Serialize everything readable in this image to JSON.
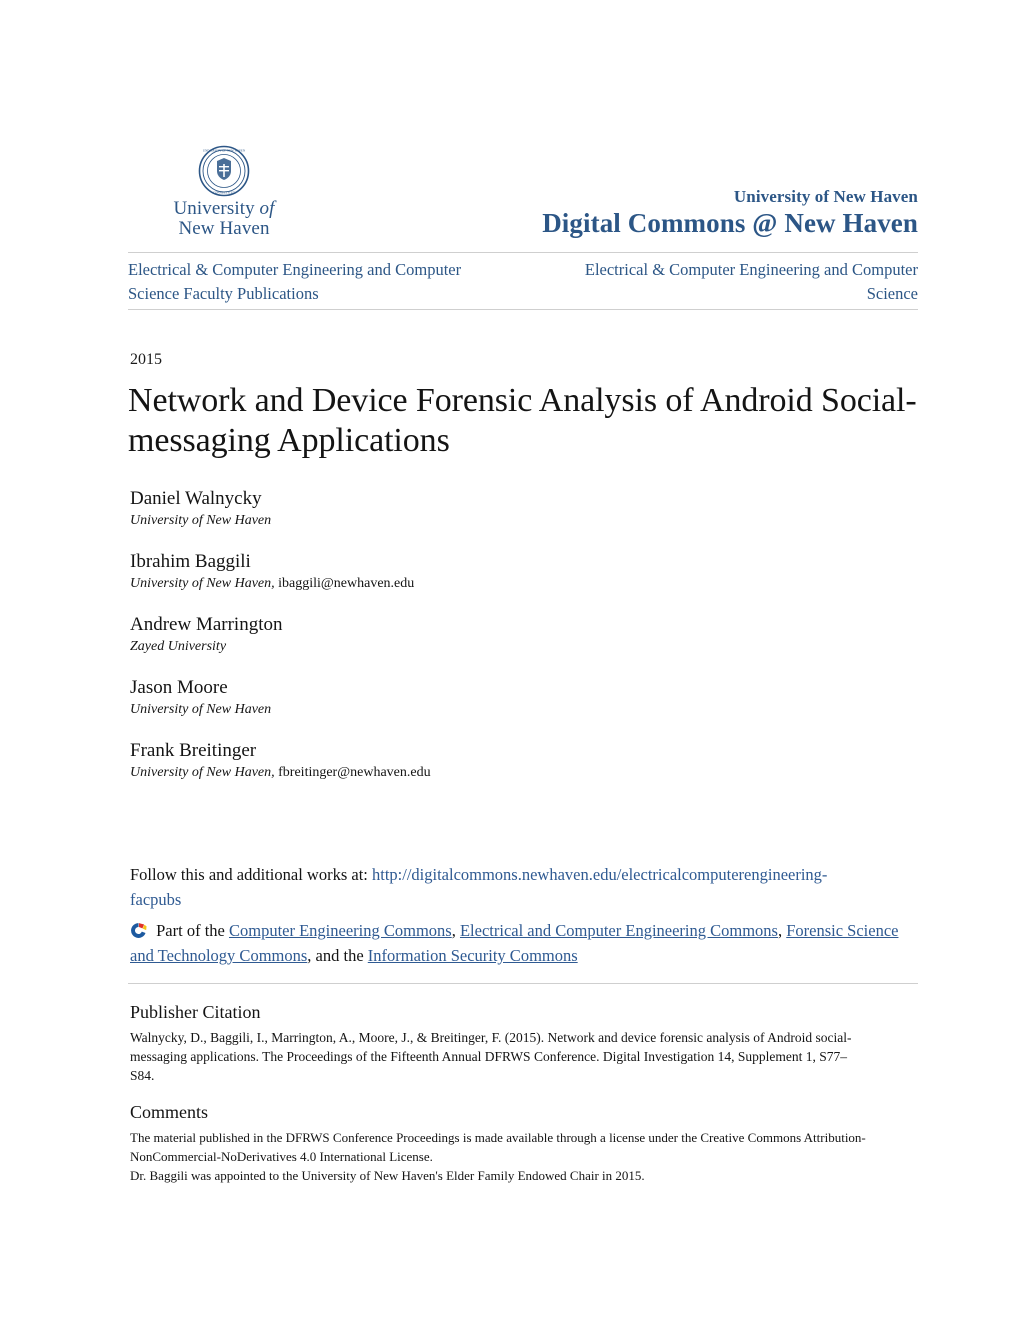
{
  "masthead": {
    "logo": {
      "seal_icon": "university-seal-icon",
      "wordmark_line1_a": "University",
      "wordmark_line1_b": "of",
      "wordmark_line2": "New Haven"
    },
    "repository_line1": "University of New Haven",
    "repository_line2": "Digital Commons @ New Haven",
    "brand_color": "#2c5686"
  },
  "departments": {
    "left": "Electrical & Computer Engineering and Computer Science Faculty Publications",
    "right": "Electrical & Computer Engineering and Computer Science"
  },
  "record": {
    "year": "2015",
    "title": "Network and Device Forensic Analysis of Android Social-messaging Applications"
  },
  "authors": [
    {
      "name": "Daniel Walnycky",
      "affiliation": "University of New Haven",
      "email": ""
    },
    {
      "name": "Ibrahim Baggili",
      "affiliation": "University of New Haven,",
      "email": "ibaggili@newhaven.edu"
    },
    {
      "name": "Andrew Marrington",
      "affiliation": "Zayed University",
      "email": ""
    },
    {
      "name": "Jason Moore",
      "affiliation": "University of New Haven",
      "email": ""
    },
    {
      "name": "Frank Breitinger",
      "affiliation": "University of New Haven,",
      "email": "fbreitinger@newhaven.edu"
    }
  ],
  "follow": {
    "prefix": "Follow this and additional works at:",
    "url": "http://digitalcommons.newhaven.edu/electricalcomputerengineering-facpubs",
    "link_color": "#2f5a92"
  },
  "part_of": {
    "icon": "digital-commons-logo-icon",
    "prefix": "Part of the",
    "links": [
      "Computer Engineering Commons",
      "Electrical and Computer Engineering Commons",
      "Forensic Science and Technology Commons",
      "Information Security Commons"
    ],
    "sep1": ",",
    "sep2": ",",
    "sep3": ", and the"
  },
  "citation": {
    "heading": "Publisher Citation",
    "text": "Walnycky, D., Baggili, I., Marrington, A., Moore, J., & Breitinger, F. (2015). Network and device forensic analysis of Android social-messaging applications. The Proceedings of the Fifteenth Annual DFRWS Conference. Digital Investigation 14, Supplement 1, S77–S84."
  },
  "comments": {
    "heading": "Comments",
    "paragraphs": [
      "The material published in the DFRWS Conference Proceedings is made available through a license under the Creative Commons Attribution-NonCommercial-NoDerivatives 4.0 International License.",
      "Dr. Baggili was appointed to the University of New Haven's Elder Family Endowed Chair in 2015."
    ]
  }
}
